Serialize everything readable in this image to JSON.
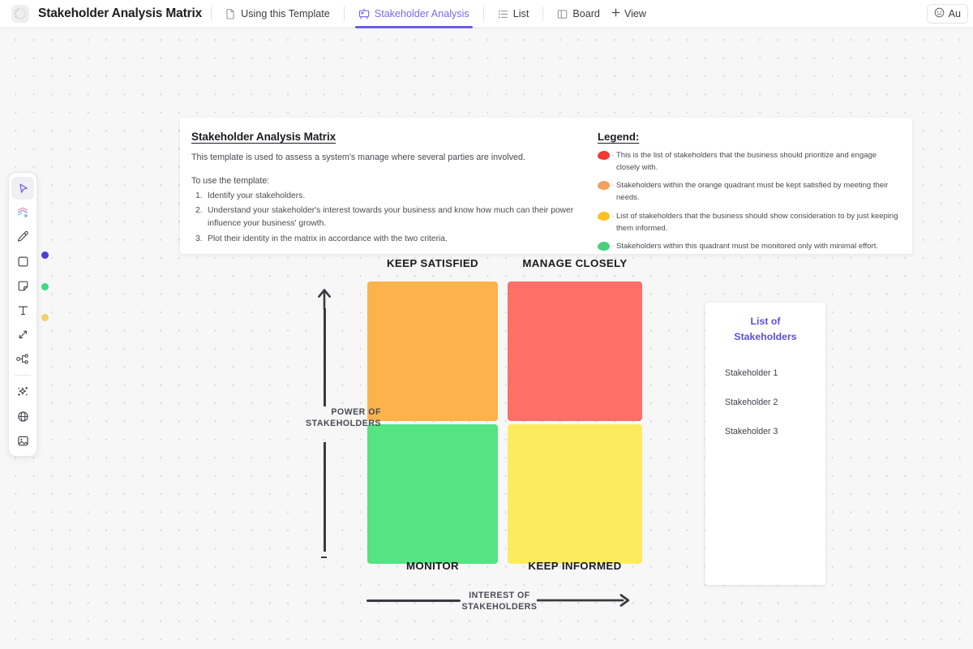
{
  "topbar": {
    "logo_icon": "loading-spinner-icon",
    "title": "Stakeholder Analysis Matrix",
    "tabs": [
      {
        "label": "Using this Template",
        "icon": "doc-icon",
        "active": false
      },
      {
        "label": "Stakeholder Analysis",
        "icon": "whiteboard-icon",
        "active": true
      },
      {
        "label": "List",
        "icon": "list-icon",
        "active": false
      },
      {
        "label": "Board",
        "icon": "board-icon",
        "active": false
      }
    ],
    "add_view_label": "View",
    "add_view_icon": "plus-icon",
    "ai_label": "Au",
    "ai_icon": "robot-icon",
    "active_tab_color": "#6b5ce7"
  },
  "toolbar": {
    "tools": [
      {
        "name": "select-cursor",
        "active": true
      },
      {
        "name": "shapes-library",
        "active": false
      },
      {
        "name": "pen",
        "active": false
      },
      {
        "name": "rectangle",
        "active": false
      },
      {
        "name": "sticky-note",
        "active": false
      },
      {
        "name": "text",
        "active": false
      },
      {
        "name": "connector",
        "active": false
      },
      {
        "name": "mindmap",
        "active": false
      },
      {
        "name": "ai-sparkle",
        "active": false
      },
      {
        "name": "embed-globe",
        "active": false
      },
      {
        "name": "image",
        "active": false
      }
    ],
    "cursor_dots": [
      "#4b3fd4",
      "#3ddc84",
      "#f2d06b"
    ]
  },
  "doc_card": {
    "heading": "Stakeholder Analysis Matrix",
    "intro": "This template is used to assess a system's manage where several parties are involved.",
    "subheading": "To use the template:",
    "steps": [
      {
        "num": "1.",
        "text": "Identify your stakeholders."
      },
      {
        "num": "2.",
        "text": "Understand your stakeholder's interest towards your business and know how much can their power influence your business' growth."
      },
      {
        "num": "3.",
        "text": "Plot their identity in the matrix in accordance with the two criteria."
      }
    ],
    "legend": {
      "heading": "Legend:",
      "entries": [
        {
          "color": "#ef3b35",
          "text": "This is the list of stakeholders that the business should prioritize and engage closely with."
        },
        {
          "color": "#f2a05e",
          "text": "Stakeholders within the orange quadrant must be kept satisfied by meeting their needs."
        },
        {
          "color": "#fac127",
          "text": "List of stakeholders that the business should show consideration to by just keeping them informed."
        },
        {
          "color": "#49cf7e",
          "text": "Stakeholders within this quadrant must be monitored only with minimal effort."
        }
      ]
    }
  },
  "matrix": {
    "quadrants": [
      {
        "id": "keep-satisfied",
        "label": "KEEP SATISFIED",
        "color": "#FCB34C"
      },
      {
        "id": "manage-closely",
        "label": "MANAGE CLOSELY",
        "color": "#FC7068"
      },
      {
        "id": "monitor",
        "label": "MONITOR",
        "color": "#55E383"
      },
      {
        "id": "keep-informed",
        "label": "KEEP INFORMED",
        "color": "#FCEB5F"
      }
    ],
    "y_axis_label_line1": "POWER OF",
    "y_axis_label_line2": "STAKEHOLDERS",
    "x_axis_label_line1": "INTEREST OF",
    "x_axis_label_line2": "STAKEHOLDERS"
  },
  "stakeholder_card": {
    "title_line1": "List of",
    "title_line2": "Stakeholders",
    "title_color": "#5b4fe0",
    "items": [
      "Stakeholder 1",
      "Stakeholder 2",
      "Stakeholder 3"
    ]
  }
}
